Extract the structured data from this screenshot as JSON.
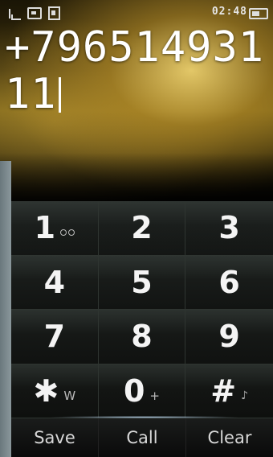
{
  "status_bar": {
    "time": "02:48",
    "icons": [
      "signal-icon",
      "memory-card-icon",
      "sim-icon",
      "battery-icon"
    ]
  },
  "dialer": {
    "number": "+79651493111"
  },
  "keypad": {
    "keys": [
      {
        "digit": "1",
        "sub": "",
        "sub_icon": "voicemail-icon"
      },
      {
        "digit": "2",
        "sub": ""
      },
      {
        "digit": "3",
        "sub": ""
      },
      {
        "digit": "4",
        "sub": ""
      },
      {
        "digit": "5",
        "sub": ""
      },
      {
        "digit": "6",
        "sub": ""
      },
      {
        "digit": "7",
        "sub": ""
      },
      {
        "digit": "8",
        "sub": ""
      },
      {
        "digit": "9",
        "sub": ""
      },
      {
        "digit": "✱",
        "sub": "W"
      },
      {
        "digit": "0",
        "sub": "+"
      },
      {
        "digit": "#",
        "sub": "",
        "sub_icon": "mute-icon"
      }
    ]
  },
  "softkeys": {
    "save": "Save",
    "call": "Call",
    "clear": "Clear"
  }
}
